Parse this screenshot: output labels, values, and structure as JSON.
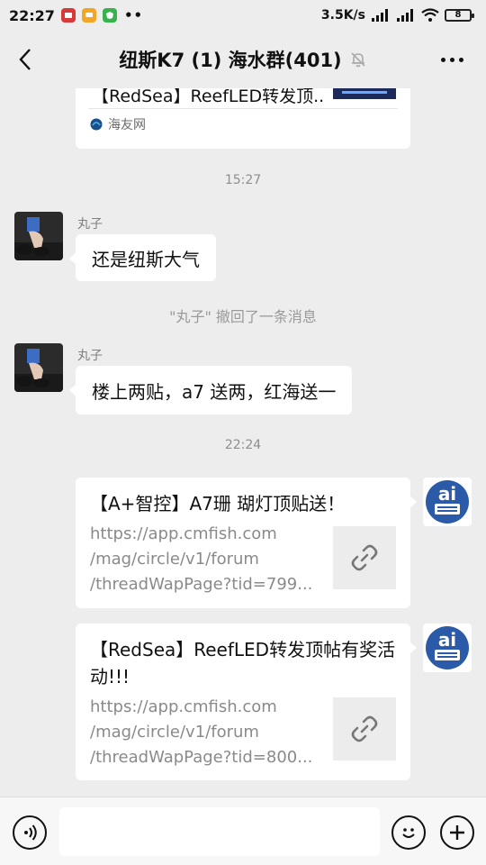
{
  "status": {
    "time": "22:27",
    "net_speed": "3.5K/s",
    "battery": "8",
    "more_dots": "••"
  },
  "header": {
    "title": "纽斯K7 (1) 海水群(401)"
  },
  "top_card": {
    "title": "【RedSea】ReefLED转发顶...",
    "source": "海友网"
  },
  "times": {
    "t1": "15:27",
    "t2": "22:24"
  },
  "messages": [
    {
      "sender": "丸子",
      "text": "还是纽斯大气"
    },
    {
      "sender": "丸子",
      "text": "楼上两贴，a7 送两，红海送一"
    }
  ],
  "recall_notice": "\"丸子\" 撤回了一条消息",
  "links": [
    {
      "title": "【A+智控】A7珊 瑚灯顶贴送！",
      "url_lines": [
        "https://app.cmfish.com",
        "/mag/circle/v1/forum",
        "/threadWapPage?tid=799..."
      ]
    },
    {
      "title": "【RedSea】ReefLED转发顶帖有奖活动!!!",
      "url_lines": [
        "https://app.cmfish.com",
        "/mag/circle/v1/forum",
        "/threadWapPage?tid=800..."
      ]
    }
  ],
  "colors": {
    "bg": "#ededed",
    "bubble": "#ffffff",
    "ai_blue": "#2a5aa8"
  }
}
